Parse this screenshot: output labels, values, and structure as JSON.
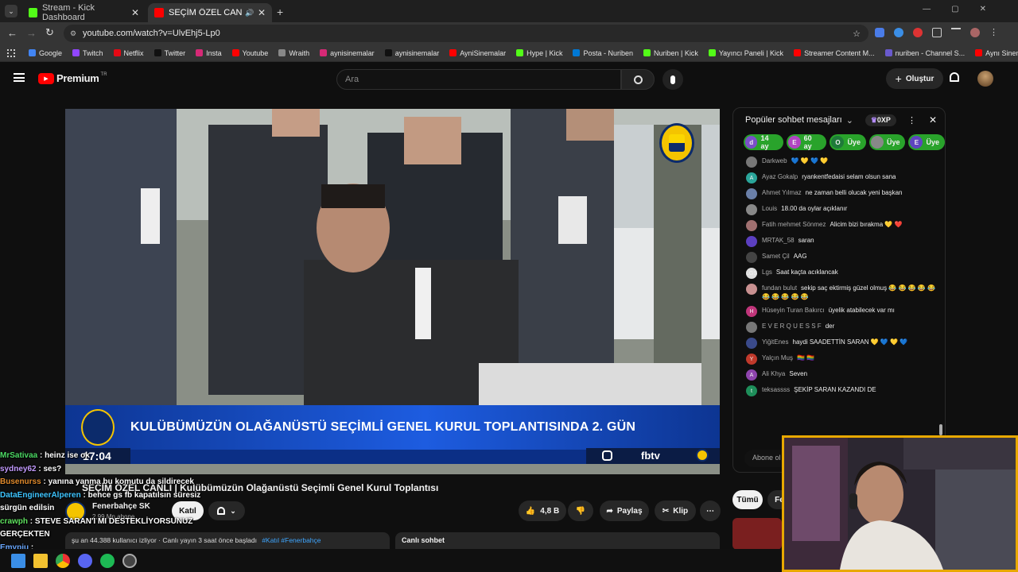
{
  "browser": {
    "tabs": [
      {
        "label": "Stream - Kick Dashboard"
      },
      {
        "label": "SEÇİM ÖZEL CANLI | Ku"
      }
    ],
    "url": "youtube.com/watch?v=UlvEhj5-Lp0",
    "bookmarks": [
      "Google",
      "Twitch",
      "Netflix",
      "Twitter",
      "Insta",
      "Youtube",
      "Wraith",
      "aynisinemalar",
      "aynisinemalar",
      "AyniSinemalar",
      "Hype | Kick",
      "Posta - Nuriben",
      "Nuriben | Kick",
      "Yayıncı Paneli | Kick",
      "Streamer Content M...",
      "nuriben - Channel S...",
      "Aynı Sinemalar - Ça..."
    ]
  },
  "youtube": {
    "logo": "Premium",
    "logo_sup": "TR",
    "search_placeholder": "Ara",
    "create_label": "Oluştur"
  },
  "video": {
    "banner": "KULÜBÜMÜZÜN OLAĞANÜSTÜ SEÇİMLİ GENEL KURUL TOPLANTISINDA 2. GÜN",
    "clock": "17:04",
    "brand": "fbtv",
    "title": "SEÇİM ÖZEL CANLI | Kulübümüzün Olağanüstü Seçimli Genel Kurul Toplantısı",
    "channel": "Fenerbahçe SK",
    "subscribers": "2,99 Mn abone",
    "join_label": "Katıl",
    "likes": "4,8 B",
    "share": "Paylaş",
    "clip": "Klip",
    "meta": "şu an 44.388 kullanıcı izliyor · Canlı yayın 3 saat önce başladı",
    "tags": "#Katıl #Fenerbahçe",
    "live_chat_tab": "Canlı sohbet"
  },
  "chat": {
    "title": "Popüler sohbet mesajları",
    "points": "0XP",
    "chips": [
      {
        "letter": "d",
        "label": "14 ay",
        "color": "#7b4fc9"
      },
      {
        "letter": "E",
        "label": "60 ay",
        "color": "#b146c2"
      },
      {
        "letter": "O",
        "label": "Üye",
        "color": "#1f7a3a"
      },
      {
        "letter": "",
        "label": "Üye",
        "color": "#888888"
      },
      {
        "letter": "E",
        "label": "Üye",
        "color": "#5e45c0"
      }
    ],
    "messages": [
      {
        "name": "Darkweb",
        "text": "💙 💛 💙 💛",
        "color": "#777777",
        "letter": ""
      },
      {
        "name": "Ayaz Gokalp",
        "text": "ryankentfedaisi selam olsun sana",
        "color": "#2aa59a",
        "letter": "A"
      },
      {
        "name": "Ahmet Yılmaz",
        "text": "ne zaman belli olucak yeni başkan",
        "color": "#6a7fa8",
        "letter": ""
      },
      {
        "name": "Louis",
        "text": "18.00 da oylar açıklanır",
        "color": "#888888",
        "letter": ""
      },
      {
        "name": "Fatih mehmet Sönmez",
        "text": "Alicim bizi bırakma 💛 ❤️",
        "color": "#a07070",
        "letter": ""
      },
      {
        "name": "MRTAK_58",
        "text": "saran",
        "color": "#5b3fc0",
        "letter": ""
      },
      {
        "name": "Samet Çil",
        "text": "AAG",
        "color": "#444444",
        "letter": ""
      },
      {
        "name": "Lgs",
        "text": "Saat kaçta acıklancak",
        "color": "#dddddd",
        "letter": "LGS"
      },
      {
        "name": "fundan bulut",
        "text": "sekip saç ektirmiş güzel olmuş 😂 😂 😂 😂 😂 😂 😂 😂 😂 😂",
        "color": "#c89090",
        "letter": ""
      },
      {
        "name": "Hüseyin Turan Bakırcı",
        "text": "üyelik atabilecek var mı",
        "color": "#c0357a",
        "letter": "H"
      },
      {
        "name": "E V E R Q U E S S F",
        "text": "der",
        "color": "#777777",
        "letter": ""
      },
      {
        "name": "YiğitEnes",
        "text": "haydi SAADETTİN SARAN 💛 💙 💛 💙",
        "color": "#3a4a8a",
        "letter": ""
      },
      {
        "name": "Yalçın Muş",
        "text": "🏳️‍🌈 🏳️‍🌈",
        "color": "#c0392b",
        "letter": "Y"
      },
      {
        "name": "Ali Khya",
        "text": "Seven",
        "color": "#8e44ad",
        "letter": "A"
      },
      {
        "name": "teksassss",
        "text": "ŞEKİP SARAN KAZANDI DE",
        "color": "#1e8e5a",
        "letter": "t"
      }
    ],
    "subscribe_hint": "Abone ol",
    "filter_all": "Tümü",
    "filter_partial": "Fe"
  },
  "kick_chat": [
    {
      "user": "MrSativaa",
      "text": ": heinz ise ok",
      "color": "#4cd964"
    },
    {
      "user": "sydney62",
      "text": ": ses?",
      "color": "#c39bff"
    },
    {
      "user": "Busenurss",
      "text": ": yanına yanma bu komutu da sildirecek",
      "color": "#e08a2c"
    },
    {
      "user": "DataEngineerAlperen",
      "text": ": bence gs fb kapatılsın süresiz sürgün edilsin",
      "color": "#3ec5ff"
    },
    {
      "user": "crawph",
      "text": ": STEVE SARAN'I MI DESTEKLİYORSUNUZ GERÇEKTEN",
      "color": "#5ee05e"
    },
    {
      "user": "Emypiu",
      "text": ":",
      "color": "#6aa8ff"
    }
  ]
}
